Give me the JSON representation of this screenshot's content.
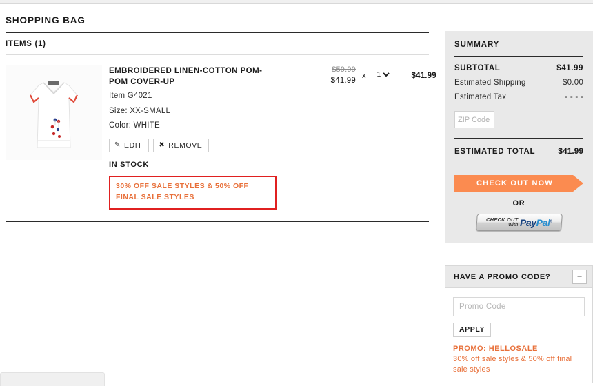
{
  "page": {
    "title": "SHOPPING BAG",
    "items_header": "ITEMS (1)"
  },
  "item": {
    "name": "EMBROIDERED LINEN-COTTON POM-POM COVER-UP",
    "item_number": "Item G4021",
    "size": "Size: XX-SMALL",
    "color": "Color: WHITE",
    "edit_label": "EDIT",
    "remove_label": "REMOVE",
    "stock_status": "IN STOCK",
    "price_original": "$59.99",
    "price_sale": "$41.99",
    "times_symbol": "x",
    "quantity": "1",
    "line_total": "$41.99",
    "promo_callout_line1": "30% OFF SALE STYLES & 50% OFF",
    "promo_callout_line2": "FINAL SALE STYLES"
  },
  "summary": {
    "title": "SUMMARY",
    "subtotal_label": "SUBTOTAL",
    "subtotal_value": "$41.99",
    "shipping_label": "Estimated Shipping",
    "shipping_value": "$0.00",
    "tax_label": "Estimated Tax",
    "tax_value": "- - - -",
    "zip_placeholder": "ZIP Code",
    "zip_value": "",
    "total_label": "ESTIMATED TOTAL",
    "total_value": "$41.99",
    "checkout_label": "CHECK OUT NOW",
    "or_label": "OR",
    "paypal_line1": "CHECK OUT",
    "paypal_line2": "with",
    "paypal_brand_pay": "Pay",
    "paypal_brand_pal": "Pal"
  },
  "promo_panel": {
    "title": "HAVE A PROMO CODE?",
    "collapse_symbol": "–",
    "input_placeholder": "Promo Code",
    "input_value": "",
    "apply_label": "APPLY",
    "applied_code": "PROMO: HELLOSALE",
    "applied_desc": "30% off sale styles & 50% off final sale styles"
  },
  "colors": {
    "accent_orange": "#fb8b50",
    "promo_orange": "#e8703a",
    "callout_red": "#e02020",
    "panel_gray": "#e9e9e9"
  }
}
